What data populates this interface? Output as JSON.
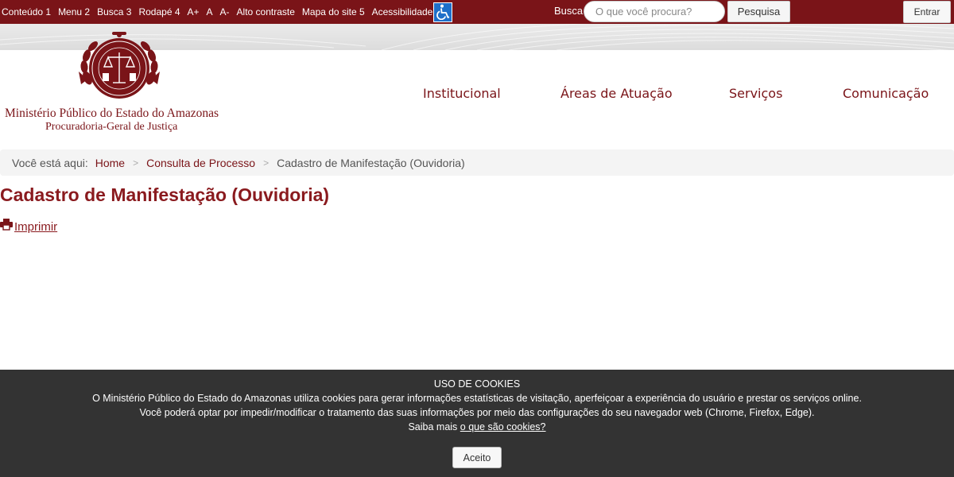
{
  "accessibility": {
    "links": [
      "Conteúdo 1",
      "Menu 2",
      "Busca 3",
      "Rodapé 4",
      "A+",
      "A",
      "A-",
      "Alto contraste",
      "Mapa do site 5",
      "Acessibilidade"
    ]
  },
  "search": {
    "label": "Busca",
    "placeholder": "O que você procura?",
    "button": "Pesquisa"
  },
  "login_label": "Entrar",
  "org": {
    "name": "Ministério Público do Estado do Amazonas",
    "subtitle": "Procuradoria-Geral de Justiça"
  },
  "nav": [
    "Institucional",
    "Áreas de Atuação",
    "Serviços",
    "Comunicação"
  ],
  "breadcrumb": {
    "label": "Você está aqui:",
    "items": [
      "Home",
      "Consulta de Processo"
    ],
    "current": "Cadastro de Manifestação (Ouvidoria)"
  },
  "page": {
    "title": "Cadastro de Manifestação (Ouvidoria)",
    "print_label": "Imprimir"
  },
  "cookie": {
    "title": "USO DE COOKIES",
    "line1": "O Ministério Público do Estado do Amazonas utiliza cookies para gerar informações estatísticas de visitação, aperfeiçoar a experiência do usuário e prestar os serviços online.",
    "line2": "Você poderá optar por impedir/modificar o tratamento das suas informações por meio das configurações do seu navegador web (Chrome, Firefox, Edge).",
    "line3_prefix": "Saiba mais",
    "line3_link": "o que são cookies?",
    "accept": "Aceito"
  },
  "colors": {
    "brand": "#7a1418",
    "title": "#8a1a1e",
    "cookie_bg": "#333333",
    "accessibility_icon": "#1e6fc9"
  }
}
